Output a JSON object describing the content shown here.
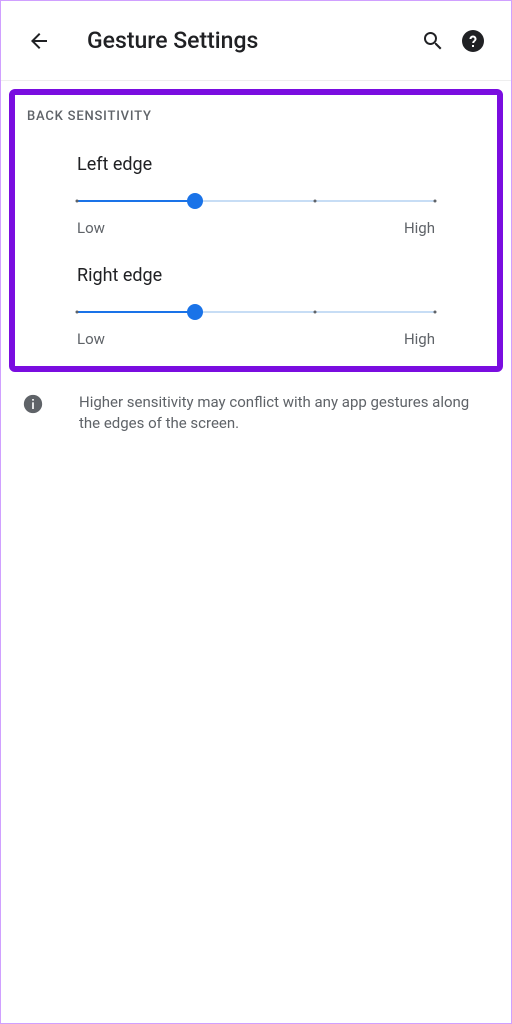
{
  "header": {
    "title": "Gesture Settings"
  },
  "section": {
    "title": "BACK SENSITIVITY"
  },
  "sliders": {
    "left": {
      "label": "Left edge",
      "low": "Low",
      "high": "High",
      "position": 33
    },
    "right": {
      "label": "Right edge",
      "low": "Low",
      "high": "High",
      "position": 33
    }
  },
  "info": {
    "text": "Higher sensitivity may conflict with any app gestures along the edges of the screen."
  }
}
